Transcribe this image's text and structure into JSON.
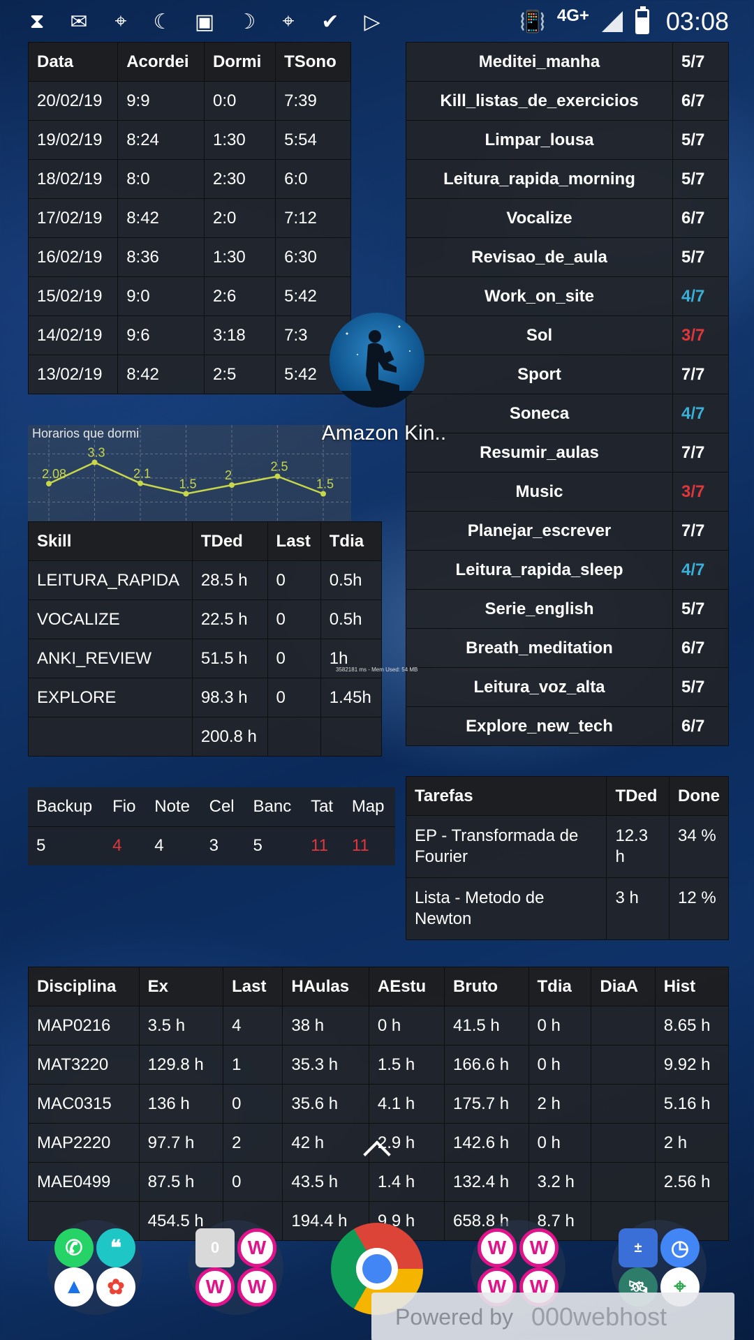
{
  "status_bar": {
    "icons": [
      "hourglass-icon",
      "gmail-icon",
      "maps-icon",
      "moon-icon",
      "photo-icon",
      "sleep-as-android-icon",
      "maps-icon",
      "check-icon",
      "play-store-icon"
    ],
    "network": "4G+",
    "time": "03:08"
  },
  "sleep_table": {
    "headers": [
      "Data",
      "Acordei",
      "Dormi",
      "TSono"
    ],
    "rows": [
      [
        "20/02/19",
        "9:9",
        "0:0",
        "7:39"
      ],
      [
        "19/02/19",
        "8:24",
        "1:30",
        "5:54"
      ],
      [
        "18/02/19",
        "8:0",
        "2:30",
        "6:0"
      ],
      [
        "17/02/19",
        "8:42",
        "2:0",
        "7:12"
      ],
      [
        "16/02/19",
        "8:36",
        "1:30",
        "6:30"
      ],
      [
        "15/02/19",
        "9:0",
        "2:6",
        "5:42"
      ],
      [
        "14/02/19",
        "9:6",
        "3:18",
        "7:3"
      ],
      [
        "13/02/19",
        "8:42",
        "2:5",
        "5:42"
      ]
    ]
  },
  "habits_table": {
    "rows": [
      {
        "name": "Meditei_manha",
        "value": "5/7",
        "color": "white"
      },
      {
        "name": "Kill_listas_de_exercicios",
        "value": "6/7",
        "color": "white"
      },
      {
        "name": "Limpar_lousa",
        "value": "5/7",
        "color": "white"
      },
      {
        "name": "Leitura_rapida_morning",
        "value": "5/7",
        "color": "white"
      },
      {
        "name": "Vocalize",
        "value": "6/7",
        "color": "white"
      },
      {
        "name": "Revisao_de_aula",
        "value": "5/7",
        "color": "white"
      },
      {
        "name": "Work_on_site",
        "value": "4/7",
        "color": "blue"
      },
      {
        "name": "Sol",
        "value": "3/7",
        "color": "red"
      },
      {
        "name": "Sport",
        "value": "7/7",
        "color": "white"
      },
      {
        "name": "Soneca",
        "value": "4/7",
        "color": "blue"
      },
      {
        "name": "Resumir_aulas",
        "value": "7/7",
        "color": "white"
      },
      {
        "name": "Music",
        "value": "3/7",
        "color": "red"
      },
      {
        "name": "Planejar_escrever",
        "value": "7/7",
        "color": "white"
      },
      {
        "name": "Leitura_rapida_sleep",
        "value": "4/7",
        "color": "blue"
      },
      {
        "name": "Serie_english",
        "value": "5/7",
        "color": "white"
      },
      {
        "name": "Breath_meditation",
        "value": "6/7",
        "color": "white"
      },
      {
        "name": "Leitura_voz_alta",
        "value": "5/7",
        "color": "white"
      },
      {
        "name": "Explore_new_tech",
        "value": "6/7",
        "color": "white"
      }
    ],
    "colors": {
      "blue": "#3ab0d8",
      "red": "#e0373d"
    }
  },
  "chart_data": {
    "type": "line",
    "title": "Horarios que dormi",
    "x": [
      1,
      2,
      3,
      4,
      5,
      6,
      7
    ],
    "values": [
      2.08,
      3.3,
      2.1,
      1.5,
      2,
      2.5,
      1.5
    ],
    "data_labels": [
      "2.08",
      "3.3",
      "2.1",
      "1.5",
      "2",
      "2.5",
      "1.5"
    ],
    "ylim": [
      0,
      4
    ],
    "grid": true,
    "line_color": "#c8d64a"
  },
  "kindle_app": {
    "label": "Amazon Kin.."
  },
  "skill_table": {
    "headers": [
      "Skill",
      "TDed",
      "Last",
      "Tdia"
    ],
    "rows": [
      [
        "LEITURA_RAPIDA",
        "28.5 h",
        "0",
        "0.5h"
      ],
      [
        "VOCALIZE",
        "22.5 h",
        "0",
        "0.5h"
      ],
      [
        "ANKI_REVIEW",
        "51.5 h",
        "0",
        "1h"
      ],
      [
        "EXPLORE",
        "98.3 h",
        "0",
        "1.45h"
      ],
      [
        "",
        "200.8 h",
        "",
        ""
      ]
    ]
  },
  "mem_overlay": "3582181 ms - Mem Used: 54 MB",
  "devices_table": {
    "headers": [
      "Backup",
      "Fio",
      "Note",
      "Cel",
      "Banc",
      "Tat",
      "Map"
    ],
    "values": [
      {
        "v": "5",
        "color": "white"
      },
      {
        "v": "4",
        "color": "red"
      },
      {
        "v": "4",
        "color": "white"
      },
      {
        "v": "3",
        "color": "white"
      },
      {
        "v": "5",
        "color": "white"
      },
      {
        "v": "11",
        "color": "red"
      },
      {
        "v": "11",
        "color": "red"
      }
    ]
  },
  "tasks_table": {
    "headers": [
      "Tarefas",
      "TDed",
      "Done"
    ],
    "rows": [
      [
        "EP - Transformada de Fourier",
        "12.3 h",
        "34 %"
      ],
      [
        "Lista - Metodo de Newton",
        "3 h",
        "12 %"
      ]
    ]
  },
  "disciplines_table": {
    "headers": [
      "Disciplina",
      "Ex",
      "Last",
      "HAulas",
      "AEstu",
      "Bruto",
      "Tdia",
      "DiaA",
      "Hist"
    ],
    "rows": [
      [
        "MAP0216",
        "3.5 h",
        "4",
        "38 h",
        "0 h",
        "41.5 h",
        "0 h",
        "",
        "8.65 h"
      ],
      [
        "MAT3220",
        "129.8 h",
        "1",
        "35.3 h",
        "1.5 h",
        "166.6 h",
        "0 h",
        "",
        "9.92 h"
      ],
      [
        "MAC0315",
        "136 h",
        "0",
        "35.6 h",
        "4.1 h",
        "175.7 h",
        "2 h",
        "",
        "5.16 h"
      ],
      [
        "MAP2220",
        "97.7 h",
        "2",
        "42 h",
        "2.9 h",
        "142.6 h",
        "0 h",
        "",
        "2 h"
      ],
      [
        "MAE0499",
        "87.5 h",
        "0",
        "43.5 h",
        "1.4 h",
        "132.4 h",
        "3.2 h",
        "",
        "2.56 h"
      ],
      [
        "",
        "454.5 h",
        "",
        "194.4 h",
        "9.9 h",
        "658.8 h",
        "8.7 h",
        "",
        ""
      ]
    ]
  },
  "dock": {
    "folder_badge": "0",
    "powered_by": "Powered by",
    "host_brand": "000webhost"
  }
}
